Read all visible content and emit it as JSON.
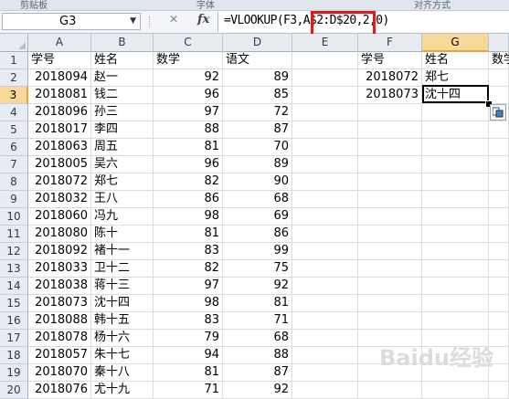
{
  "ribbon": {
    "groups": [
      "剪贴板",
      "字体",
      "对齐方式"
    ]
  },
  "formula_bar": {
    "name_box": "G3",
    "fx_label": "fx",
    "formula_part1": "=VLOOKUP(F3,",
    "formula_part2": "A$2:D$20",
    "formula_part3": ",2,0)",
    "highlight_color": "#e01a1a"
  },
  "columns": [
    "A",
    "B",
    "C",
    "D",
    "E",
    "F",
    "G"
  ],
  "rows": [
    "1",
    "2",
    "3",
    "4",
    "5",
    "6",
    "7",
    "8",
    "9",
    "10",
    "11",
    "12",
    "13",
    "14",
    "15",
    "16",
    "17",
    "18",
    "19",
    "20"
  ],
  "table": {
    "headers": [
      "学号",
      "姓名",
      "数学",
      "语文"
    ],
    "records": [
      [
        "2018094",
        "赵一",
        "92",
        "89"
      ],
      [
        "2018081",
        "钱二",
        "96",
        "85"
      ],
      [
        "2018096",
        "孙三",
        "97",
        "72"
      ],
      [
        "2018017",
        "李四",
        "88",
        "87"
      ],
      [
        "2018063",
        "周五",
        "81",
        "70"
      ],
      [
        "2018005",
        "吴六",
        "96",
        "89"
      ],
      [
        "2018072",
        "郑七",
        "82",
        "90"
      ],
      [
        "2018032",
        "王八",
        "86",
        "68"
      ],
      [
        "2018060",
        "冯九",
        "98",
        "69"
      ],
      [
        "2018080",
        "陈十",
        "81",
        "86"
      ],
      [
        "2018092",
        "褚十一",
        "83",
        "99"
      ],
      [
        "2018033",
        "卫十二",
        "82",
        "75"
      ],
      [
        "2018038",
        "蒋十三",
        "97",
        "92"
      ],
      [
        "2018073",
        "沈十四",
        "98",
        "81"
      ],
      [
        "2018088",
        "韩十五",
        "83",
        "71"
      ],
      [
        "2018078",
        "杨十六",
        "79",
        "68"
      ],
      [
        "2018057",
        "朱十七",
        "94",
        "88"
      ],
      [
        "2018070",
        "秦十八",
        "81",
        "87"
      ],
      [
        "2018076",
        "尤十九",
        "71",
        "92"
      ]
    ]
  },
  "lookup": {
    "headers": [
      "学号",
      "姓名",
      "数学"
    ],
    "records": [
      [
        "2018072",
        "郑七"
      ],
      [
        "2018073",
        "沈十四"
      ]
    ]
  },
  "selected_cell": "G3",
  "watermark": "Baidu经验",
  "colors": {
    "header_bg": "#e8ecf1",
    "active_header": "#f9d99a",
    "gridline": "#dadcdd"
  }
}
